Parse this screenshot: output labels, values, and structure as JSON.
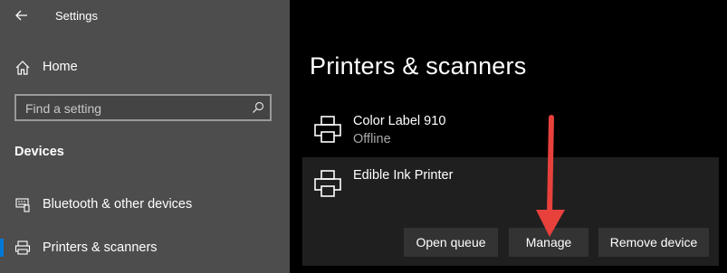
{
  "window": {
    "app_title": "Settings"
  },
  "sidebar": {
    "home_label": "Home",
    "search": {
      "placeholder": "Find a setting",
      "value": ""
    },
    "section_heading": "Devices",
    "items": [
      {
        "label": "Bluetooth & other devices",
        "icon": "bluetooth-icon"
      },
      {
        "label": "Printers & scanners",
        "icon": "printer-icon",
        "selected": true
      }
    ]
  },
  "main": {
    "title": "Printers & scanners",
    "printers": [
      {
        "name": "Color Label 910",
        "status": "Offline"
      },
      {
        "name": "Edible Ink Printer",
        "status": ""
      }
    ],
    "actions": {
      "open_queue": "Open queue",
      "manage": "Manage",
      "remove_device": "Remove device"
    }
  },
  "colors": {
    "sidebar_bg": "#4d4d4d",
    "main_bg": "#000000",
    "accent": "#0078d7",
    "annotation_arrow": "#e8413c"
  }
}
